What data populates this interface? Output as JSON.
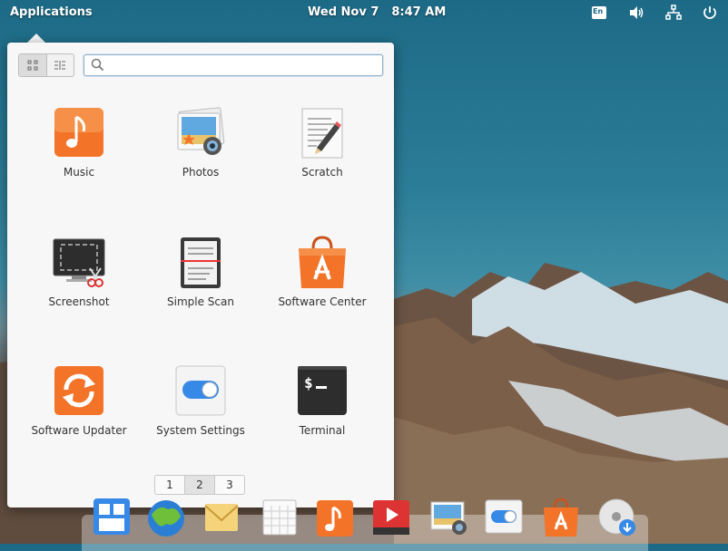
{
  "panel": {
    "applications_label": "Applications",
    "date": "Wed Nov  7",
    "time": "8:47 AM",
    "indicators": [
      "keyboard-layout-icon",
      "volume-icon",
      "network-icon",
      "power-icon"
    ],
    "keyboard_layout": "En"
  },
  "launcher": {
    "view_modes": [
      "grid-view-icon",
      "category-view-icon"
    ],
    "search": {
      "placeholder": "",
      "value": ""
    },
    "apps": [
      {
        "name": "Music",
        "icon": "music-icon",
        "color": "#f37329"
      },
      {
        "name": "Photos",
        "icon": "photos-icon",
        "color": "#3f8ed9"
      },
      {
        "name": "Scratch",
        "icon": "scratch-icon",
        "color": "#e8e8e8"
      },
      {
        "name": "Screenshot",
        "icon": "screenshot-icon",
        "color": "#333333"
      },
      {
        "name": "Simple Scan",
        "icon": "scanner-icon",
        "color": "#555555"
      },
      {
        "name": "Software Center",
        "icon": "software-center-icon",
        "color": "#f37329"
      },
      {
        "name": "Software Updater",
        "icon": "software-updater-icon",
        "color": "#f37329"
      },
      {
        "name": "System Settings",
        "icon": "system-settings-icon",
        "color": "#3689e6"
      },
      {
        "name": "Terminal",
        "icon": "terminal-icon",
        "color": "#2d2d2d"
      }
    ],
    "pages": [
      "1",
      "2",
      "3"
    ],
    "active_page": "2"
  },
  "dock": {
    "items": [
      "multitasking-view-icon",
      "web-browser-icon",
      "mail-icon",
      "calendar-icon",
      "music-icon",
      "videos-icon",
      "photos-icon",
      "system-settings-icon",
      "software-center-icon",
      "disk-installer-icon"
    ]
  }
}
